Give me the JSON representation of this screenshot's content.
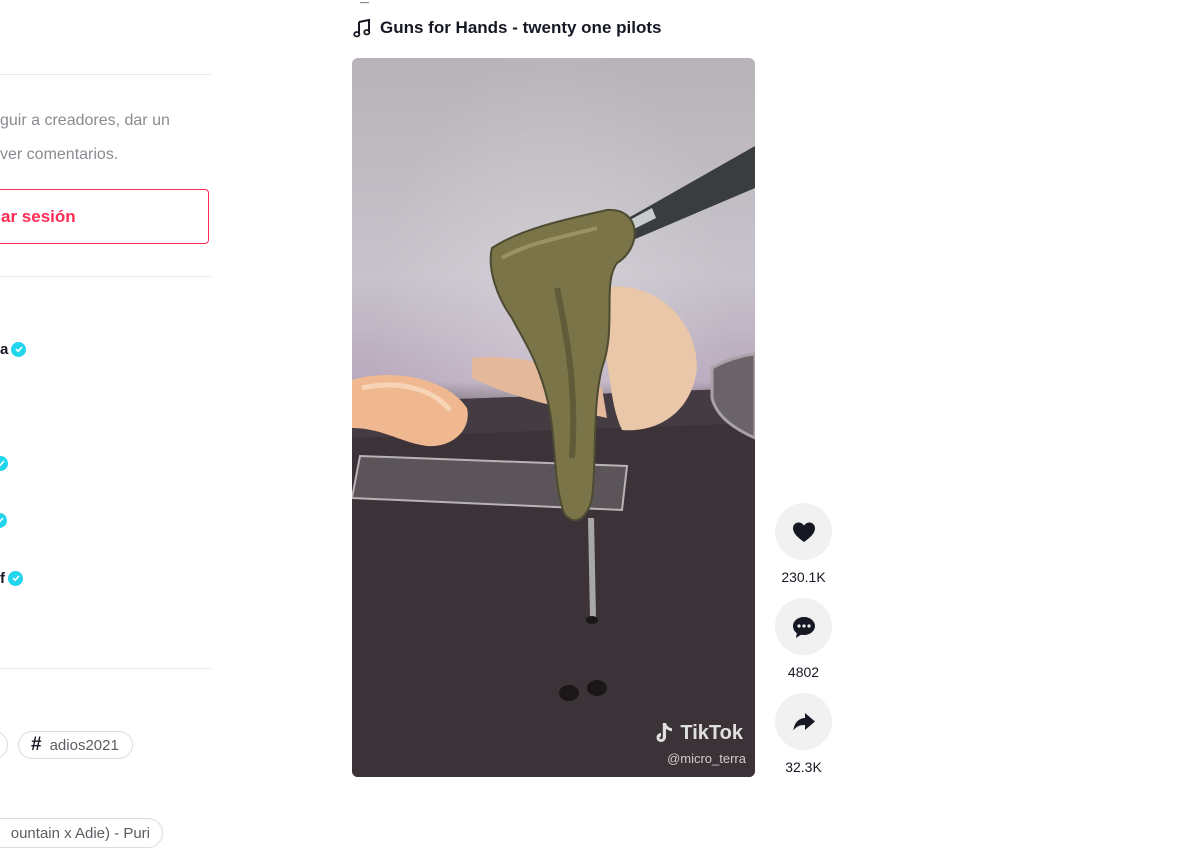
{
  "sidebar": {
    "login_prompt_line1": "guir a creadores, dar un",
    "login_prompt_line2": "ver comentarios.",
    "login_button": "ar sesión",
    "suggested_accounts": [
      {
        "name": "a"
      },
      {
        "name": ""
      },
      {
        "name": ""
      },
      {
        "name": "f"
      }
    ],
    "tags": [
      {
        "label": "adios2021"
      }
    ],
    "music_pill": "ountain x Adie) - Puri"
  },
  "video": {
    "author_partial": "_",
    "song": "Guns for Hands - twenty one pilots",
    "watermark_brand": "TikTok",
    "watermark_user": "@micro_terra"
  },
  "actions": {
    "likes": "230.1K",
    "comments": "4802",
    "shares": "32.3K"
  },
  "colors": {
    "accent": "#fe2c55",
    "verified": "#20d5ec"
  }
}
